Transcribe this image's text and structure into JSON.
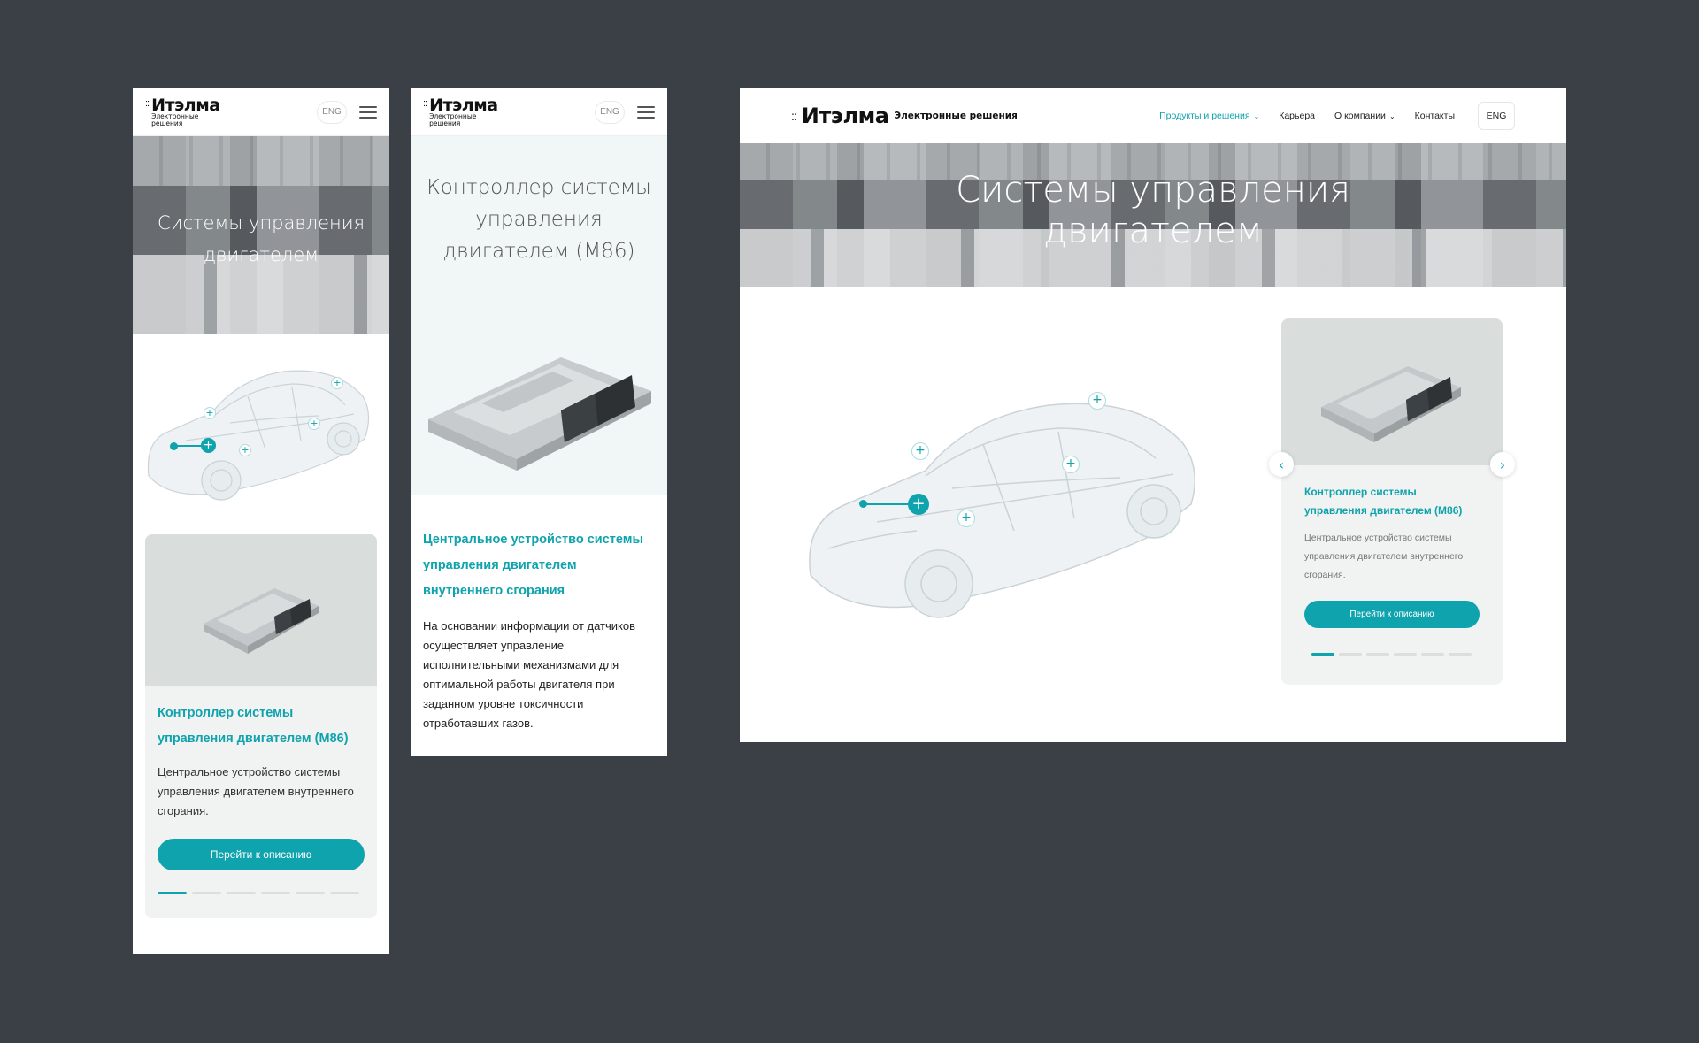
{
  "logo": {
    "name": "Итэлма",
    "dots": "::",
    "subtitle": "Электронные решения"
  },
  "header": {
    "lang": "ENG",
    "nav": [
      {
        "label": "Продукты и решения",
        "chevron": "⌄"
      },
      {
        "label": "Карьера"
      },
      {
        "label": "О компании",
        "chevron": "⌄"
      },
      {
        "label": "Контакты"
      }
    ]
  },
  "hero": {
    "title_line1": "Системы управления",
    "title_line2": "двигателем"
  },
  "card": {
    "title": "Контроллер системы управления двигателем (М86)",
    "desc_mobile": "Центральное устройство системы управления двигателем внутреннего сгорания.",
    "desc_desktop": "Центральное устройство системы управления двигателем внутреннего сгорания.",
    "button": "Перейти к описанию",
    "slides_total": 6,
    "active_slide": 1
  },
  "product_page": {
    "title": "Контроллер системы управления двигателем (М86)",
    "subtitle": "Центральное устройство системы управления двигателем внутреннего сгорания",
    "body": "На основании информации от датчиков осуществляет управление исполнительными механизмами для оптимальной работы двигателя при заданном уровне токсичности отработавших газов."
  },
  "icons": {
    "hotspot": "+",
    "arrow_left": "‹",
    "arrow_right": "›",
    "menu": "hamburger-icon"
  },
  "colors": {
    "accent": "#0fa3ad",
    "background": "#3a4045",
    "card_bg": "#f1f2f2"
  }
}
